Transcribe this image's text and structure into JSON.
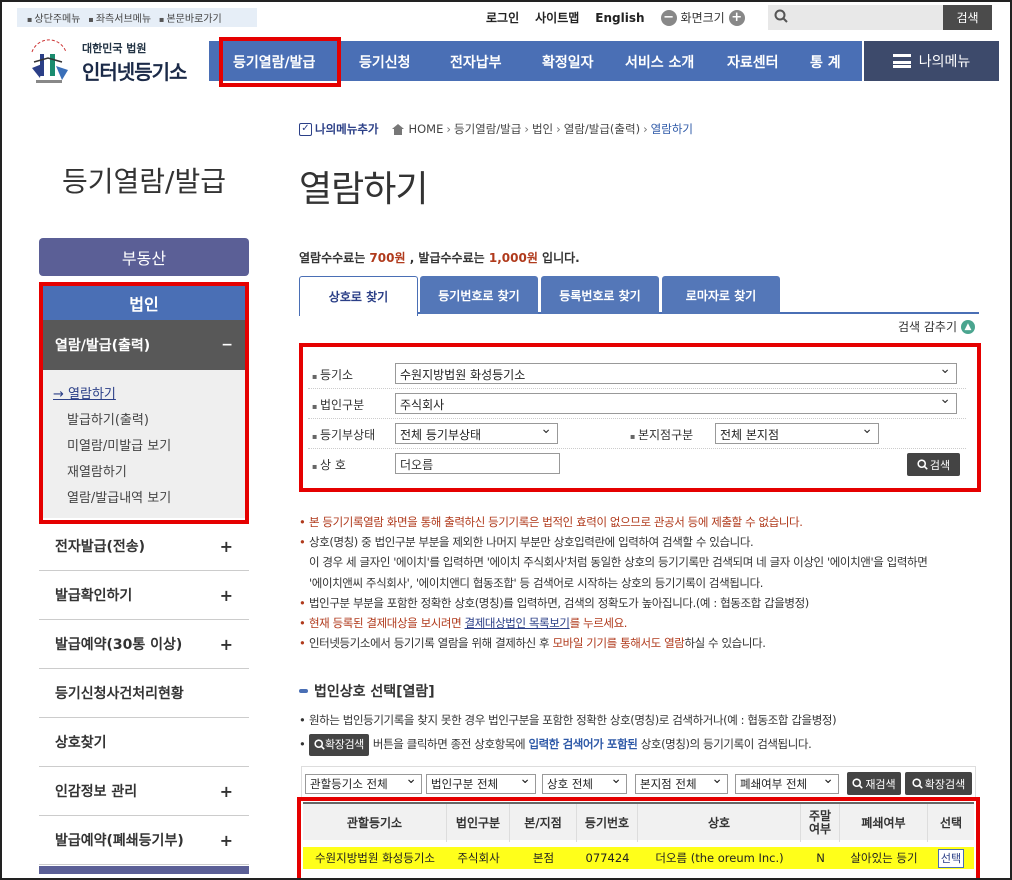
{
  "skip_links": [
    "상단주메뉴",
    "좌측서브메뉴",
    "본문바로가기"
  ],
  "util": {
    "login": "로그인",
    "sitemap": "사이트맵",
    "english": "English",
    "zoom": "화면크기",
    "search_button": "검색"
  },
  "logo": {
    "top": "대한민국 법원",
    "main": "인터넷등기소"
  },
  "gnb": [
    "등기열람/발급",
    "등기신청",
    "전자납부",
    "확정일자",
    "서비스 소개",
    "자료센터",
    "통 계"
  ],
  "my_menu": "나의메뉴",
  "breadcrumb": {
    "add_my_menu": "나의메뉴추가",
    "items": [
      "HOME",
      "등기열람/발급",
      "법인",
      "열람/발급(출력)",
      "열람하기"
    ]
  },
  "side": {
    "title": "등기열람/발급",
    "real_estate": "부동산",
    "corp": "법인",
    "open_group": "열람/발급(출력)",
    "open_toggle": "−",
    "subitems": [
      "열람하기",
      "발급하기(출력)",
      "미열람/미발급 보기",
      "재열람하기",
      "열람/발급내역 보기"
    ],
    "items": [
      "전자발급(전송)",
      "발급확인하기",
      "발급예약(30통 이상)",
      "등기신청사건처리현황",
      "상호찾기",
      "인감정보 관리",
      "발급예약(폐쇄등기부)"
    ]
  },
  "page_title": "열람하기",
  "fee": {
    "pre": "열람수수료는 ",
    "read_fee": "700원",
    "mid": " , 발급수수료는 ",
    "issue_fee": "1,000원",
    "post": " 입니다."
  },
  "tabs": [
    "상호로 찾기",
    "등기번호로 찾기",
    "등록번호로 찾기",
    "로마자로 찾기"
  ],
  "collapse_label": "검색 감추기",
  "form": {
    "office_label": "등기소",
    "office_value": "수원지방법원 화성등기소",
    "corp_type_label": "법인구분",
    "corp_type_value": "주식회사",
    "status_label": "등기부상태",
    "status_value": "전체 등기부상태",
    "branch_label": "본지점구분",
    "branch_value": "전체 본지점",
    "name_label": "상 호",
    "name_value": "더오름",
    "search_button": "검색"
  },
  "notes": {
    "n1": "본 등기기록열람 화면을 통해 출력하신 등기기록은 법적인 효력이 없으므로 관공서 등에 제출할 수 없습니다.",
    "n2": "상호(명칭) 중 법인구분 부분을 제외한 나머지 부분만 상호입력란에 입력하여 검색할 수 있습니다.",
    "n2b": "이 경우 세 글자인 '에이치'를 입력하면 '에이치 주식회사'처럼 동일한 상호의 등기기록만 검색되며 네 글자 이상인 '에이치앤'을 입력하면",
    "n2c": "'에이치앤씨 주식회사', '에이치앤디 협동조합' 등 검색어로 시작하는 상호의 등기기록이 검색됩니다.",
    "n3": "법인구분 부분을 포함한 정확한 상호(명칭)를 입력하면, 검색의 정확도가 높아집니다.(예 : 협동조합 갑을병정)",
    "n4a": "현재 등록된 결제대상을 보시려면 ",
    "n4link": "결제대상법인 목록보기",
    "n4b": "를 누르세요.",
    "n5a": "인터넷등기소에서 등기기록 열람을 위해 결제하신 후 ",
    "n5red": "모바일 기기를 통해서도 열람",
    "n5b": "하실 수 있습니다."
  },
  "section": {
    "title": "법인상호 선택[열람]",
    "note1": "원하는 법인등기기록을 찾지 못한 경우 법인구분을 포함한 정확한 상호(명칭)로 검색하거나(예 : 협동조합 갑을병정)",
    "ext_button": "확장검색",
    "note2a": "버튼을 클릭하면 종전 상호항목에 ",
    "note2blue": "입력한 검색어가 포함된",
    "note2b": " 상호(명칭)의 등기기록이 검색됩니다."
  },
  "filters": [
    "관할등기소 전체",
    "법인구분 전체",
    "상호 전체",
    "본지점 전체",
    "폐쇄여부 전체"
  ],
  "filter_buttons": {
    "research": "재검색",
    "extended": "확장검색"
  },
  "table": {
    "headers": [
      "관할등기소",
      "법인구분",
      "본/지점",
      "등기번호",
      "상호",
      "주말\n여부",
      "폐쇄여부",
      "선택"
    ],
    "row": {
      "office": "수원지방법원 화성등기소",
      "type": "주식회사",
      "branch": "본점",
      "number": "077424",
      "name": "더오름 (the oreum Inc.)",
      "weekend": "N",
      "status": "살아있는 등기",
      "select": "선택"
    }
  },
  "colors": {
    "nav_blue": "#4a6fb5",
    "sidebar_purple": "#5b5f96",
    "highlight_red": "#e50000",
    "row_yellow": "#ffff1a",
    "accent_red": "#b03a1c"
  }
}
